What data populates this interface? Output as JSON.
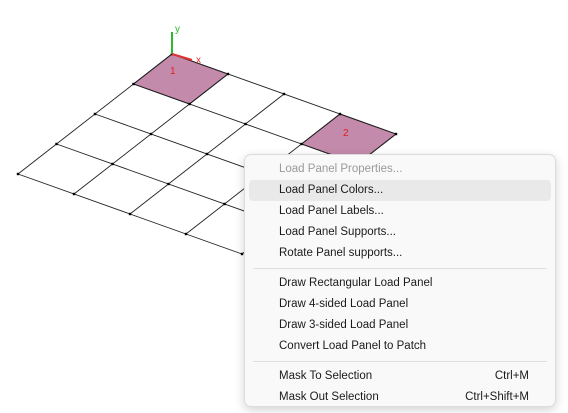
{
  "canvas": {
    "axis_y_label": "y",
    "axis_x_label": "x",
    "panels": [
      {
        "label": "1",
        "color": "#c48aab"
      },
      {
        "label": "2",
        "color": "#c48aab"
      }
    ],
    "grid_color": "#222222",
    "axis_y_color": "#2db82d",
    "axis_x_color": "#e03030",
    "panel_label_color": "#e02020"
  },
  "context_menu": {
    "groups": [
      [
        {
          "label": "Load Panel Properties...",
          "enabled": false
        },
        {
          "label": "Load Panel Colors...",
          "enabled": true,
          "highlighted": true
        },
        {
          "label": "Load Panel Labels...",
          "enabled": true
        },
        {
          "label": "Load Panel Supports...",
          "enabled": true
        },
        {
          "label": "Rotate Panel supports...",
          "enabled": true
        }
      ],
      [
        {
          "label": "Draw Rectangular Load Panel",
          "enabled": true
        },
        {
          "label": "Draw 4-sided Load Panel",
          "enabled": true
        },
        {
          "label": "Draw 3-sided Load Panel",
          "enabled": true
        },
        {
          "label": "Convert Load Panel to Patch",
          "enabled": true
        }
      ],
      [
        {
          "label": "Mask To Selection",
          "enabled": true,
          "shortcut": "Ctrl+M"
        },
        {
          "label": "Mask Out Selection",
          "enabled": true,
          "shortcut": "Ctrl+Shift+M"
        }
      ]
    ]
  }
}
